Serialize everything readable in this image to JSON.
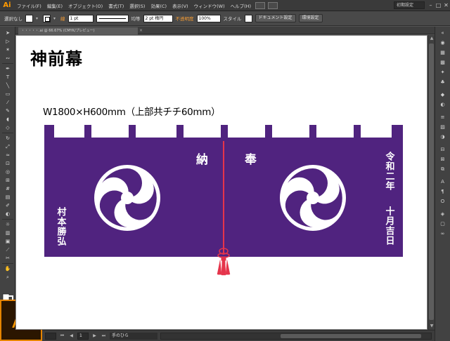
{
  "app": {
    "logo_small": "Ai",
    "logo_badge": "Ai",
    "accent_color": "#ff9a00"
  },
  "menubar": {
    "items": [
      "ファイル(F)",
      "編集(E)",
      "オブジェクト(O)",
      "書式(T)",
      "選択(S)",
      "効果(C)",
      "表示(V)",
      "ウィンドウ(W)",
      "ヘルプ(H)"
    ],
    "workspace": "初期設定",
    "window_buttons": [
      "–",
      "□",
      "✕"
    ]
  },
  "controlbar": {
    "selection": "選択なし",
    "stroke_label": "線",
    "stroke_weight": "1 pt",
    "stroke_profile": "均等",
    "brush": "2 pt 楕円",
    "opacity_label": "不透明度",
    "opacity_value": "100%",
    "style_label": "スタイル",
    "doc_setup_button": "ドキュメント設定",
    "preferences_button": "環境設定"
  },
  "document": {
    "tab_title": "・・・・・.ai @ 66.67% (CMYK/プレビュー)",
    "title": "神前幕",
    "dimensions": "W1800×H600mm（上部共チチ60mm）",
    "banner": {
      "fabric_color": "#50237f",
      "text_color": "#ffffff",
      "cord_color": "#e5344b",
      "center_left_char": "納",
      "center_right_char": "奉",
      "left_vertical": "村本勝弘",
      "right_vertical_1": "令和二年",
      "right_vertical_2": "十月吉日",
      "emblem": "mitsudomoe"
    }
  },
  "tools": [
    "selection-tool-icon",
    "direct-selection-tool-icon",
    "magic-wand-icon",
    "lasso-icon",
    "pen-tool-icon",
    "type-tool-icon",
    "line-tool-icon",
    "rectangle-tool-icon",
    "paintbrush-icon",
    "pencil-icon",
    "blob-brush-icon",
    "eraser-icon",
    "rotate-icon",
    "scale-icon",
    "width-tool-icon",
    "free-transform-icon",
    "shape-builder-icon",
    "perspective-grid-icon",
    "mesh-icon",
    "gradient-icon",
    "eyedropper-icon",
    "blend-icon",
    "symbol-sprayer-icon",
    "graph-icon",
    "artboard-icon",
    "slice-icon",
    "hand-tool-icon",
    "zoom-tool-icon"
  ],
  "statusbar": {
    "zoom": "",
    "page": "1",
    "tool_name": "手のひら"
  }
}
